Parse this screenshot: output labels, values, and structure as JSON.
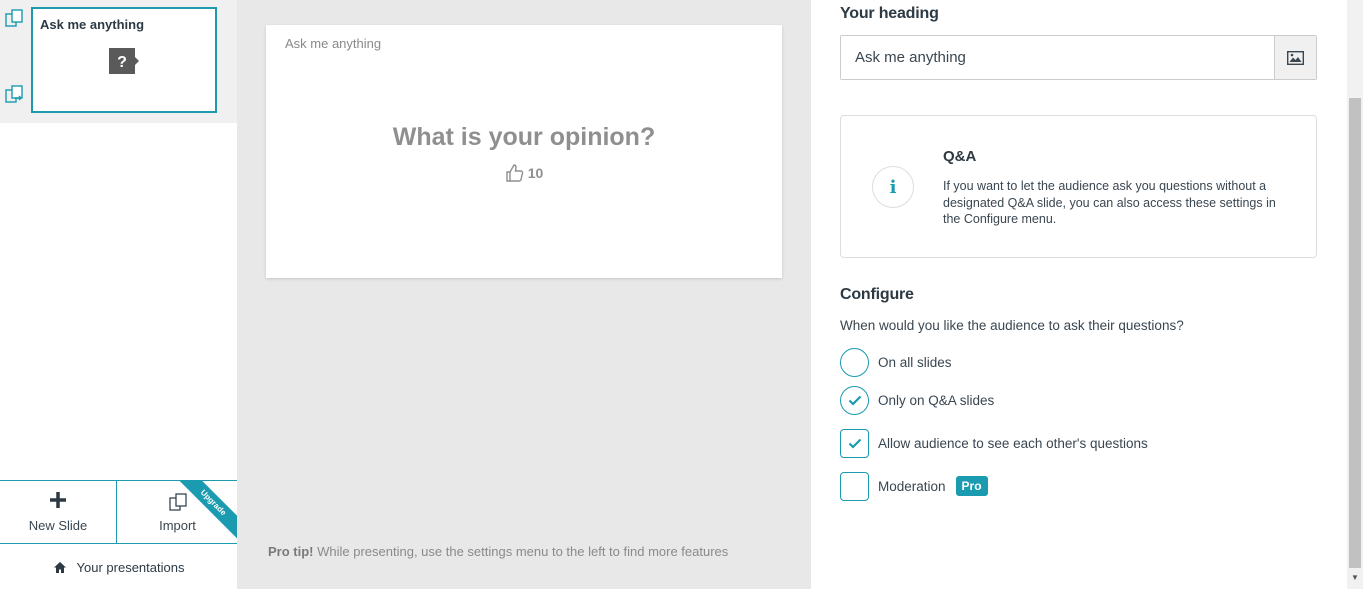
{
  "sidebar": {
    "slide_thumb_title": "Ask me anything",
    "new_slide_label": "New Slide",
    "import_label": "Import",
    "upgrade_ribbon": "Upgrade",
    "your_presentations_label": "Your presentations"
  },
  "slide": {
    "heading": "Ask me anything",
    "question": "What is your opinion?",
    "likes": "10"
  },
  "pro_tip": {
    "bold": "Pro tip!",
    "text": " While presenting, use the settings menu to the left to find more features"
  },
  "panel": {
    "heading_label": "Your heading",
    "heading_value": "Ask me anything",
    "info_title": "Q&A",
    "info_text": "If you want to let the audience ask you questions without a designated Q&A slide, you can also access these settings in the Configure menu.",
    "configure_label": "Configure",
    "configure_question": "When would you like the audience to ask their questions?",
    "options": {
      "all_slides": {
        "label": "On all slides",
        "selected": false
      },
      "qa_slides": {
        "label": "Only on Q&A slides",
        "selected": true
      },
      "see_others": {
        "label": "Allow audience to see each other's questions",
        "checked": true
      },
      "moderation": {
        "label": "Moderation",
        "checked": false,
        "badge": "Pro"
      }
    }
  },
  "colors": {
    "accent": "#1a9bb0",
    "canvas_bg": "#e8e8e8",
    "text": "#3a4650"
  }
}
